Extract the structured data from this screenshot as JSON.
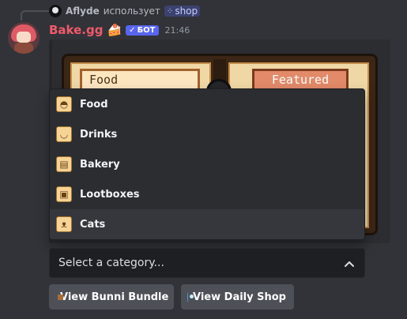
{
  "reply": {
    "username": "Aflyde",
    "action": "использует",
    "command": "shop"
  },
  "message": {
    "username": "Bake.gg",
    "badge": "БОТ",
    "timestamp": "21:46"
  },
  "banner": {
    "left_tab": "Food",
    "right_tab": "Featured"
  },
  "dropdown": {
    "options": [
      {
        "label": "Food",
        "icon": "pie-icon"
      },
      {
        "label": "Drinks",
        "icon": "cup-icon"
      },
      {
        "label": "Bakery",
        "icon": "bread-icon"
      },
      {
        "label": "Lootboxes",
        "icon": "box-icon"
      },
      {
        "label": "Cats",
        "icon": "cat-icon"
      }
    ],
    "highlighted_index": 4
  },
  "select": {
    "placeholder": "Select a category..."
  },
  "buttons": {
    "bundle": "View Bunni Bundle",
    "daily_shop": "View Daily Shop"
  }
}
